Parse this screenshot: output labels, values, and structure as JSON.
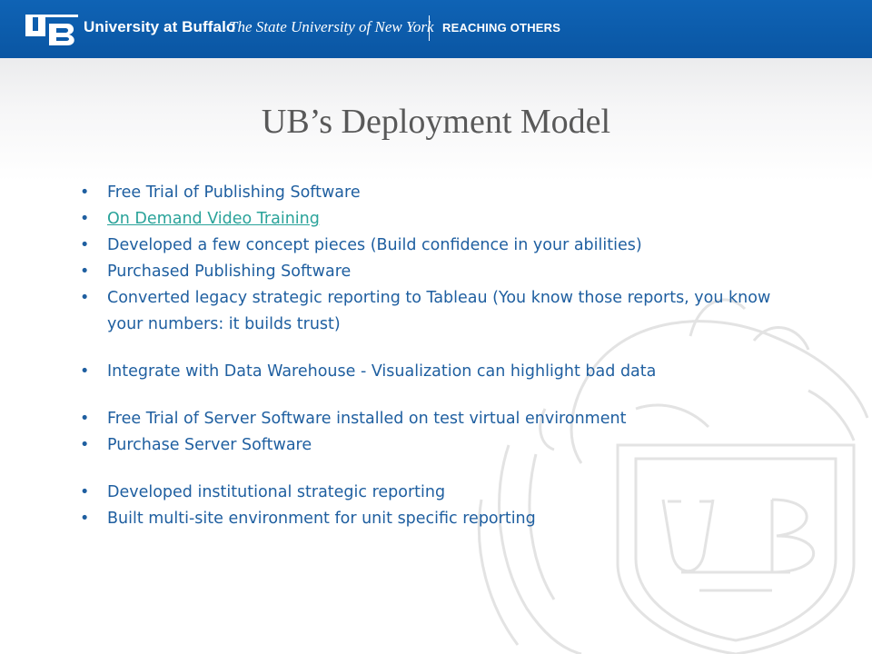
{
  "header": {
    "university": "University at Buffalo",
    "suny": "The State University of New York",
    "tagline": "REACHING OTHERS",
    "logo_icon": "ub-monogram-logo"
  },
  "colors": {
    "banner": "#0b5aa8",
    "title": "#595959",
    "body_text": "#1f5fa0",
    "link": "#2aa39a"
  },
  "slide": {
    "title": "UB’s Deployment Model",
    "bullets": [
      {
        "text": "Free Trial of Publishing Software"
      },
      {
        "text": "On Demand Video Training",
        "link": true
      },
      {
        "text": "Developed a few concept pieces (Build confidence in your abilities)"
      },
      {
        "text": "Purchased Publishing Software"
      },
      {
        "text": "Converted legacy strategic reporting to Tableau (You know those reports, you know your numbers: it builds trust)"
      },
      {
        "text": "Integrate with Data Warehouse - Visualization can highlight bad data"
      },
      {
        "text": "Free Trial of Server Software installed on test virtual environment"
      },
      {
        "text": "Purchase Server Software"
      },
      {
        "text": "Developed institutional strategic reporting"
      },
      {
        "text": "Built multi-site environment for unit specific reporting"
      }
    ]
  }
}
